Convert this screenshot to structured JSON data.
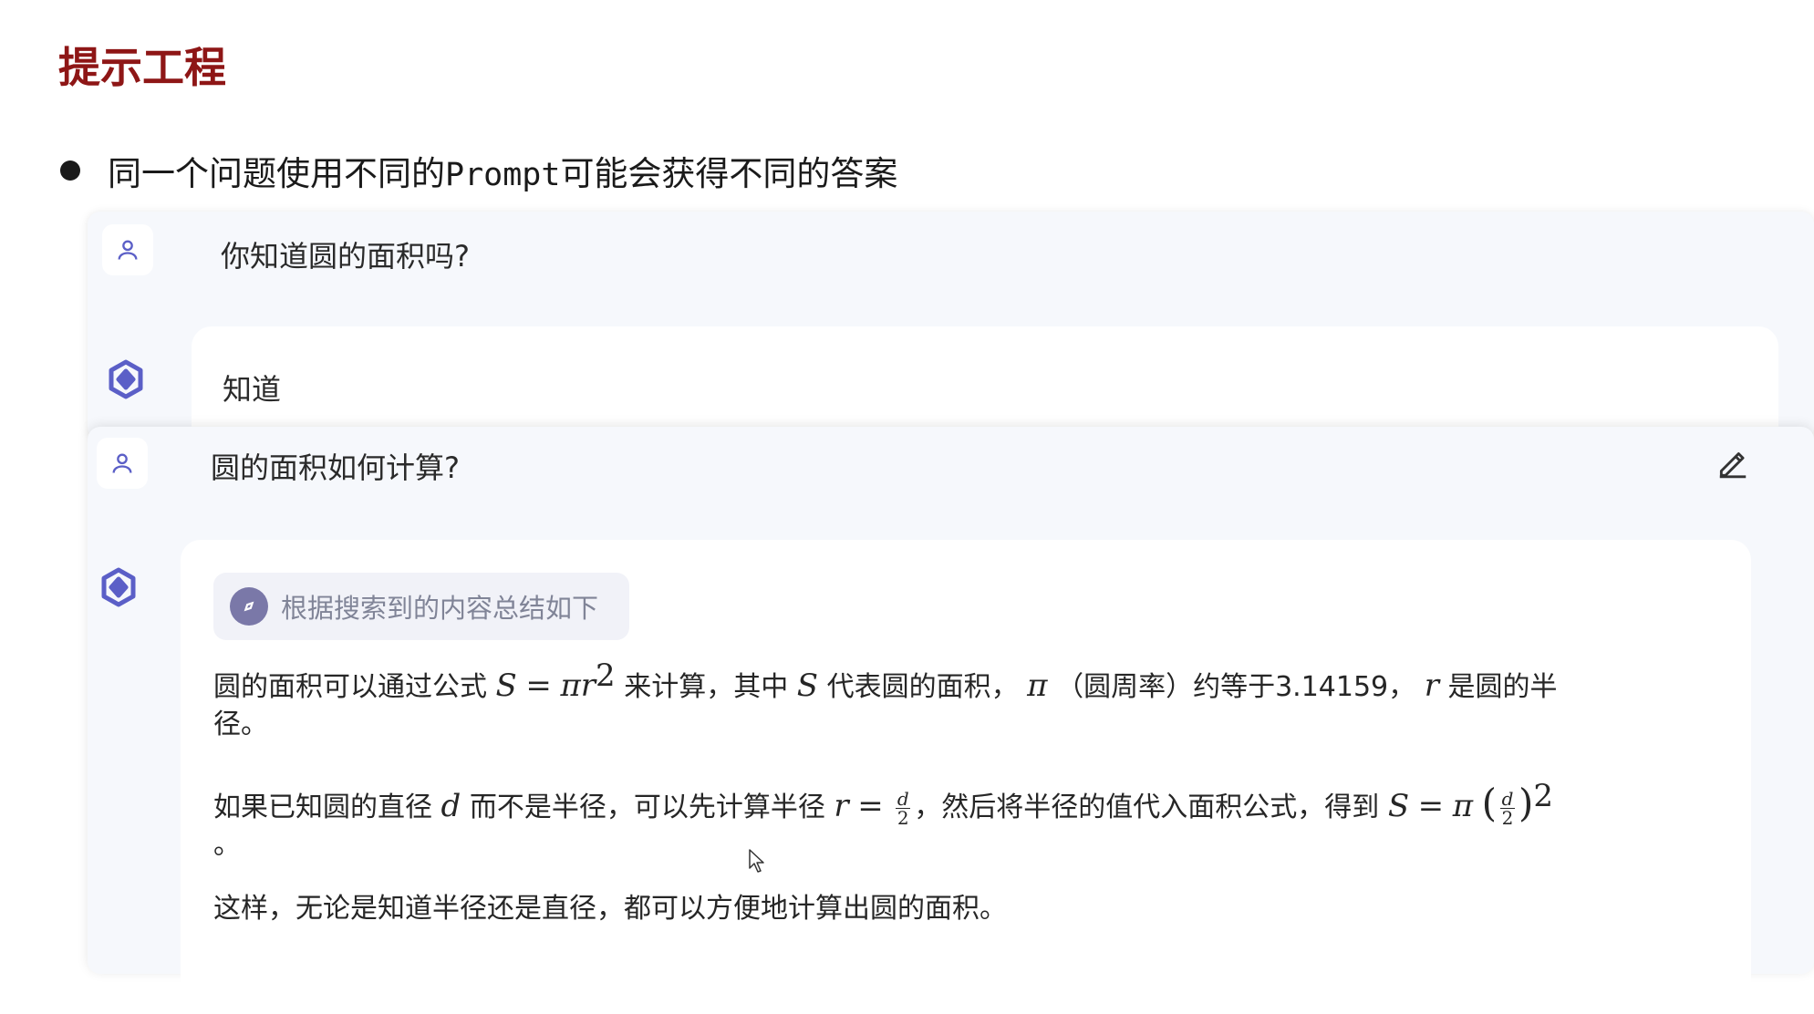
{
  "slide": {
    "title": "提示工程",
    "bullet": {
      "prefix": "同一个问题使用不同的",
      "code": "Prompt",
      "suffix": "可能会获得不同的答案"
    }
  },
  "chat1": {
    "user_question": "你知道圆的面积吗?",
    "bot_answer": "知道"
  },
  "chat2": {
    "user_question": "圆的面积如何计算?",
    "search_chip": "根据搜索到的内容总结如下",
    "p1": {
      "a": "圆的面积可以通过公式",
      "b": "来计算，其中",
      "c": "代表圆的面积，",
      "d": "（圆周率）约等于3.14159，",
      "e": "是圆的半",
      "f": "径。"
    },
    "p2": {
      "a": "如果已知圆的直径",
      "b": "而不是半径，可以先计算半径",
      "c": "，然后将半径的值代入面积公式，得到",
      "end": "。"
    },
    "p3": "这样，无论是知道半径还是直径，都可以方便地计算出圆的面积。"
  },
  "colors": {
    "title": "#8e1616",
    "panel_bg": "#f6f8fc",
    "accent": "#5b5fc7",
    "chip_icon": "#7a78a8"
  },
  "icons": [
    "user-icon",
    "bot-logo-icon",
    "edit-icon",
    "compass-icon",
    "mouse-cursor-icon"
  ]
}
